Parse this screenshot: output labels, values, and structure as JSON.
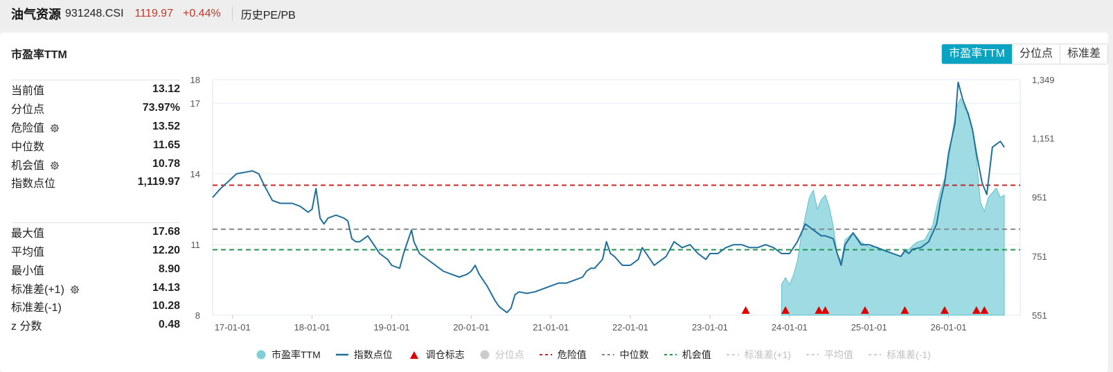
{
  "header": {
    "name": "油气资源",
    "code": "931248.CSI",
    "price": "1119.97",
    "change": "+0.44%",
    "link": "历史PE/PB"
  },
  "panel": {
    "title": "市盈率TTM",
    "toggles": [
      "市盈率TTM",
      "分位点",
      "标准差"
    ],
    "active_toggle": "市盈率TTM"
  },
  "stats_top": [
    {
      "label": "当前值",
      "value": "13.12",
      "gear": false
    },
    {
      "label": "分位点",
      "value": "73.97%",
      "gear": false
    },
    {
      "label": "危险值",
      "value": "13.52",
      "gear": true
    },
    {
      "label": "中位数",
      "value": "11.65",
      "gear": false
    },
    {
      "label": "机会值",
      "value": "10.78",
      "gear": true
    },
    {
      "label": "指数点位",
      "value": "1,119.97",
      "gear": false
    }
  ],
  "stats_bottom": [
    {
      "label": "最大值",
      "value": "17.68",
      "gear": false
    },
    {
      "label": "平均值",
      "value": "12.20",
      "gear": false
    },
    {
      "label": "最小值",
      "value": "8.90",
      "gear": false
    },
    {
      "label": "标准差(+1)",
      "value": "14.13",
      "gear": true
    },
    {
      "label": "标准差(-1)",
      "value": "10.28",
      "gear": false
    },
    {
      "label": "z 分数",
      "value": "0.48",
      "gear": false
    }
  ],
  "legend": [
    {
      "label": "市盈率TTM",
      "kind": "dot",
      "color": "#7fcfd9",
      "active": true
    },
    {
      "label": "指数点位",
      "kind": "line",
      "color": "#1f6f9a",
      "active": true
    },
    {
      "label": "调仓标志",
      "kind": "triangle",
      "color": "#e00000",
      "active": true
    },
    {
      "label": "分位点",
      "kind": "dot",
      "color": "#cccccc",
      "active": false
    },
    {
      "label": "危险值",
      "kind": "dash",
      "color": "#d62020",
      "active": true
    },
    {
      "label": "中位数",
      "kind": "dash",
      "color": "#888888",
      "active": true
    },
    {
      "label": "机会值",
      "kind": "dash",
      "color": "#1a9a4a",
      "active": true
    },
    {
      "label": "标准差(+1)",
      "kind": "dash",
      "color": "#cccccc",
      "active": false
    },
    {
      "label": "平均值",
      "kind": "dash",
      "color": "#cccccc",
      "active": false
    },
    {
      "label": "标准差(-1)",
      "kind": "dash",
      "color": "#cccccc",
      "active": false
    }
  ],
  "chart_data": {
    "type": "line",
    "x_ticks": [
      "17-01-01",
      "18-01-01",
      "19-01-01",
      "20-01-01",
      "21-01-01",
      "22-01-01",
      "23-01-01",
      "24-01-01",
      "25-01-01",
      "26-01-01"
    ],
    "x_range": [
      2016.75,
      2026.9
    ],
    "y_left": {
      "ticks": [
        "18",
        "17",
        "14",
        "11",
        "8"
      ],
      "tick_values": [
        18,
        17,
        14,
        11,
        8
      ],
      "range": [
        8,
        18
      ]
    },
    "y_right": {
      "ticks": [
        "1,349",
        "1,151",
        "951",
        "751",
        "551"
      ],
      "tick_values": [
        1349,
        1151,
        951,
        751,
        551
      ],
      "range": [
        551,
        1349
      ]
    },
    "reference_lines": [
      {
        "name": "危险值",
        "value": 13.52,
        "color": "#d62020"
      },
      {
        "name": "中位数",
        "value": 11.65,
        "color": "#888888"
      },
      {
        "name": "机会值",
        "value": 10.78,
        "color": "#1a9a4a"
      }
    ],
    "series": [
      {
        "name": "指数点位",
        "axis": "right",
        "color": "#1f6f9a",
        "points": [
          [
            2016.75,
            950
          ],
          [
            2016.85,
            980
          ],
          [
            2016.95,
            1005
          ],
          [
            2017.05,
            1030
          ],
          [
            2017.15,
            1035
          ],
          [
            2017.25,
            1040
          ],
          [
            2017.33,
            1030
          ],
          [
            2017.4,
            990
          ],
          [
            2017.5,
            940
          ],
          [
            2017.6,
            930
          ],
          [
            2017.75,
            930
          ],
          [
            2017.85,
            920
          ],
          [
            2017.95,
            900
          ],
          [
            2018.0,
            910
          ],
          [
            2018.05,
            980
          ],
          [
            2018.1,
            880
          ],
          [
            2018.15,
            860
          ],
          [
            2018.2,
            880
          ],
          [
            2018.3,
            890
          ],
          [
            2018.4,
            880
          ],
          [
            2018.45,
            870
          ],
          [
            2018.5,
            810
          ],
          [
            2018.55,
            800
          ],
          [
            2018.6,
            800
          ],
          [
            2018.7,
            820
          ],
          [
            2018.75,
            800
          ],
          [
            2018.8,
            780
          ],
          [
            2018.85,
            760
          ],
          [
            2018.95,
            740
          ],
          [
            2019.0,
            720
          ],
          [
            2019.1,
            710
          ],
          [
            2019.15,
            760
          ],
          [
            2019.2,
            800
          ],
          [
            2019.25,
            840
          ],
          [
            2019.28,
            800
          ],
          [
            2019.35,
            760
          ],
          [
            2019.45,
            740
          ],
          [
            2019.55,
            720
          ],
          [
            2019.65,
            700
          ],
          [
            2019.75,
            690
          ],
          [
            2019.85,
            680
          ],
          [
            2019.95,
            690
          ],
          [
            2020.0,
            700
          ],
          [
            2020.05,
            720
          ],
          [
            2020.1,
            690
          ],
          [
            2020.2,
            650
          ],
          [
            2020.3,
            600
          ],
          [
            2020.35,
            580
          ],
          [
            2020.45,
            560
          ],
          [
            2020.5,
            575
          ],
          [
            2020.55,
            620
          ],
          [
            2020.6,
            630
          ],
          [
            2020.7,
            625
          ],
          [
            2020.8,
            630
          ],
          [
            2020.9,
            640
          ],
          [
            2021.0,
            650
          ],
          [
            2021.1,
            660
          ],
          [
            2021.2,
            660
          ],
          [
            2021.3,
            670
          ],
          [
            2021.4,
            680
          ],
          [
            2021.45,
            700
          ],
          [
            2021.5,
            710
          ],
          [
            2021.55,
            710
          ],
          [
            2021.65,
            740
          ],
          [
            2021.7,
            800
          ],
          [
            2021.75,
            760
          ],
          [
            2021.8,
            750
          ],
          [
            2021.9,
            720
          ],
          [
            2022.0,
            720
          ],
          [
            2022.1,
            740
          ],
          [
            2022.15,
            780
          ],
          [
            2022.2,
            760
          ],
          [
            2022.3,
            720
          ],
          [
            2022.35,
            730
          ],
          [
            2022.45,
            750
          ],
          [
            2022.55,
            800
          ],
          [
            2022.65,
            780
          ],
          [
            2022.75,
            790
          ],
          [
            2022.85,
            760
          ],
          [
            2022.95,
            740
          ],
          [
            2023.0,
            760
          ],
          [
            2023.1,
            760
          ],
          [
            2023.2,
            780
          ],
          [
            2023.3,
            790
          ],
          [
            2023.4,
            790
          ],
          [
            2023.5,
            780
          ],
          [
            2023.6,
            780
          ],
          [
            2023.7,
            790
          ],
          [
            2023.8,
            780
          ],
          [
            2023.9,
            760
          ],
          [
            2024.0,
            760
          ],
          [
            2024.1,
            800
          ],
          [
            2024.2,
            860
          ],
          [
            2024.3,
            840
          ],
          [
            2024.4,
            820
          ],
          [
            2024.45,
            820
          ],
          [
            2024.55,
            810
          ],
          [
            2024.6,
            760
          ],
          [
            2024.65,
            720
          ],
          [
            2024.7,
            790
          ],
          [
            2024.8,
            830
          ],
          [
            2024.9,
            790
          ],
          [
            2025.0,
            790
          ],
          [
            2025.1,
            780
          ],
          [
            2025.2,
            770
          ],
          [
            2025.3,
            760
          ],
          [
            2025.4,
            750
          ],
          [
            2025.45,
            770
          ],
          [
            2025.5,
            760
          ],
          [
            2025.55,
            775
          ],
          [
            2025.65,
            780
          ],
          [
            2025.75,
            800
          ],
          [
            2025.85,
            860
          ],
          [
            2025.9,
            940
          ],
          [
            2025.95,
            1000
          ],
          [
            2026.0,
            1100
          ],
          [
            2026.08,
            1200
          ],
          [
            2026.12,
            1340
          ],
          [
            2026.18,
            1280
          ],
          [
            2026.25,
            1230
          ],
          [
            2026.3,
            1180
          ],
          [
            2026.35,
            1100
          ],
          [
            2026.42,
            1000
          ],
          [
            2026.48,
            960
          ],
          [
            2026.55,
            1120
          ],
          [
            2026.6,
            1130
          ],
          [
            2026.65,
            1140
          ],
          [
            2026.7,
            1120
          ]
        ]
      },
      {
        "name": "市盈率TTM",
        "axis": "left",
        "color": "#7fcfd9",
        "points": [
          [
            2023.9,
            9.3
          ],
          [
            2023.95,
            9.6
          ],
          [
            2024.0,
            9.3
          ],
          [
            2024.05,
            9.7
          ],
          [
            2024.1,
            10.3
          ],
          [
            2024.15,
            11.4
          ],
          [
            2024.2,
            12.2
          ],
          [
            2024.25,
            13.0
          ],
          [
            2024.3,
            13.3
          ],
          [
            2024.35,
            12.5
          ],
          [
            2024.4,
            12.9
          ],
          [
            2024.45,
            13.1
          ],
          [
            2024.5,
            12.6
          ],
          [
            2024.55,
            11.8
          ],
          [
            2024.6,
            10.6
          ],
          [
            2024.65,
            10.3
          ],
          [
            2024.7,
            11.2
          ],
          [
            2024.8,
            11.5
          ],
          [
            2024.9,
            11.1
          ],
          [
            2025.0,
            10.9
          ],
          [
            2025.1,
            10.9
          ],
          [
            2025.2,
            10.7
          ],
          [
            2025.3,
            10.6
          ],
          [
            2025.4,
            10.5
          ],
          [
            2025.5,
            10.8
          ],
          [
            2025.6,
            11.1
          ],
          [
            2025.7,
            11.2
          ],
          [
            2025.8,
            11.8
          ],
          [
            2025.85,
            12.6
          ],
          [
            2025.9,
            13.3
          ],
          [
            2025.95,
            13.8
          ],
          [
            2026.0,
            14.5
          ],
          [
            2026.05,
            15.8
          ],
          [
            2026.1,
            16.8
          ],
          [
            2026.15,
            17.2
          ],
          [
            2026.2,
            16.8
          ],
          [
            2026.25,
            16.6
          ],
          [
            2026.3,
            15.9
          ],
          [
            2026.35,
            14.6
          ],
          [
            2026.4,
            12.8
          ],
          [
            2026.45,
            12.4
          ],
          [
            2026.5,
            13.0
          ],
          [
            2026.55,
            13.2
          ],
          [
            2026.6,
            13.4
          ],
          [
            2026.65,
            13.0
          ],
          [
            2026.7,
            13.1
          ]
        ]
      }
    ],
    "rebalance_markers": [
      2023.45,
      2023.95,
      2024.37,
      2024.45,
      2024.95,
      2025.45,
      2025.95,
      2026.35,
      2026.45
    ]
  }
}
